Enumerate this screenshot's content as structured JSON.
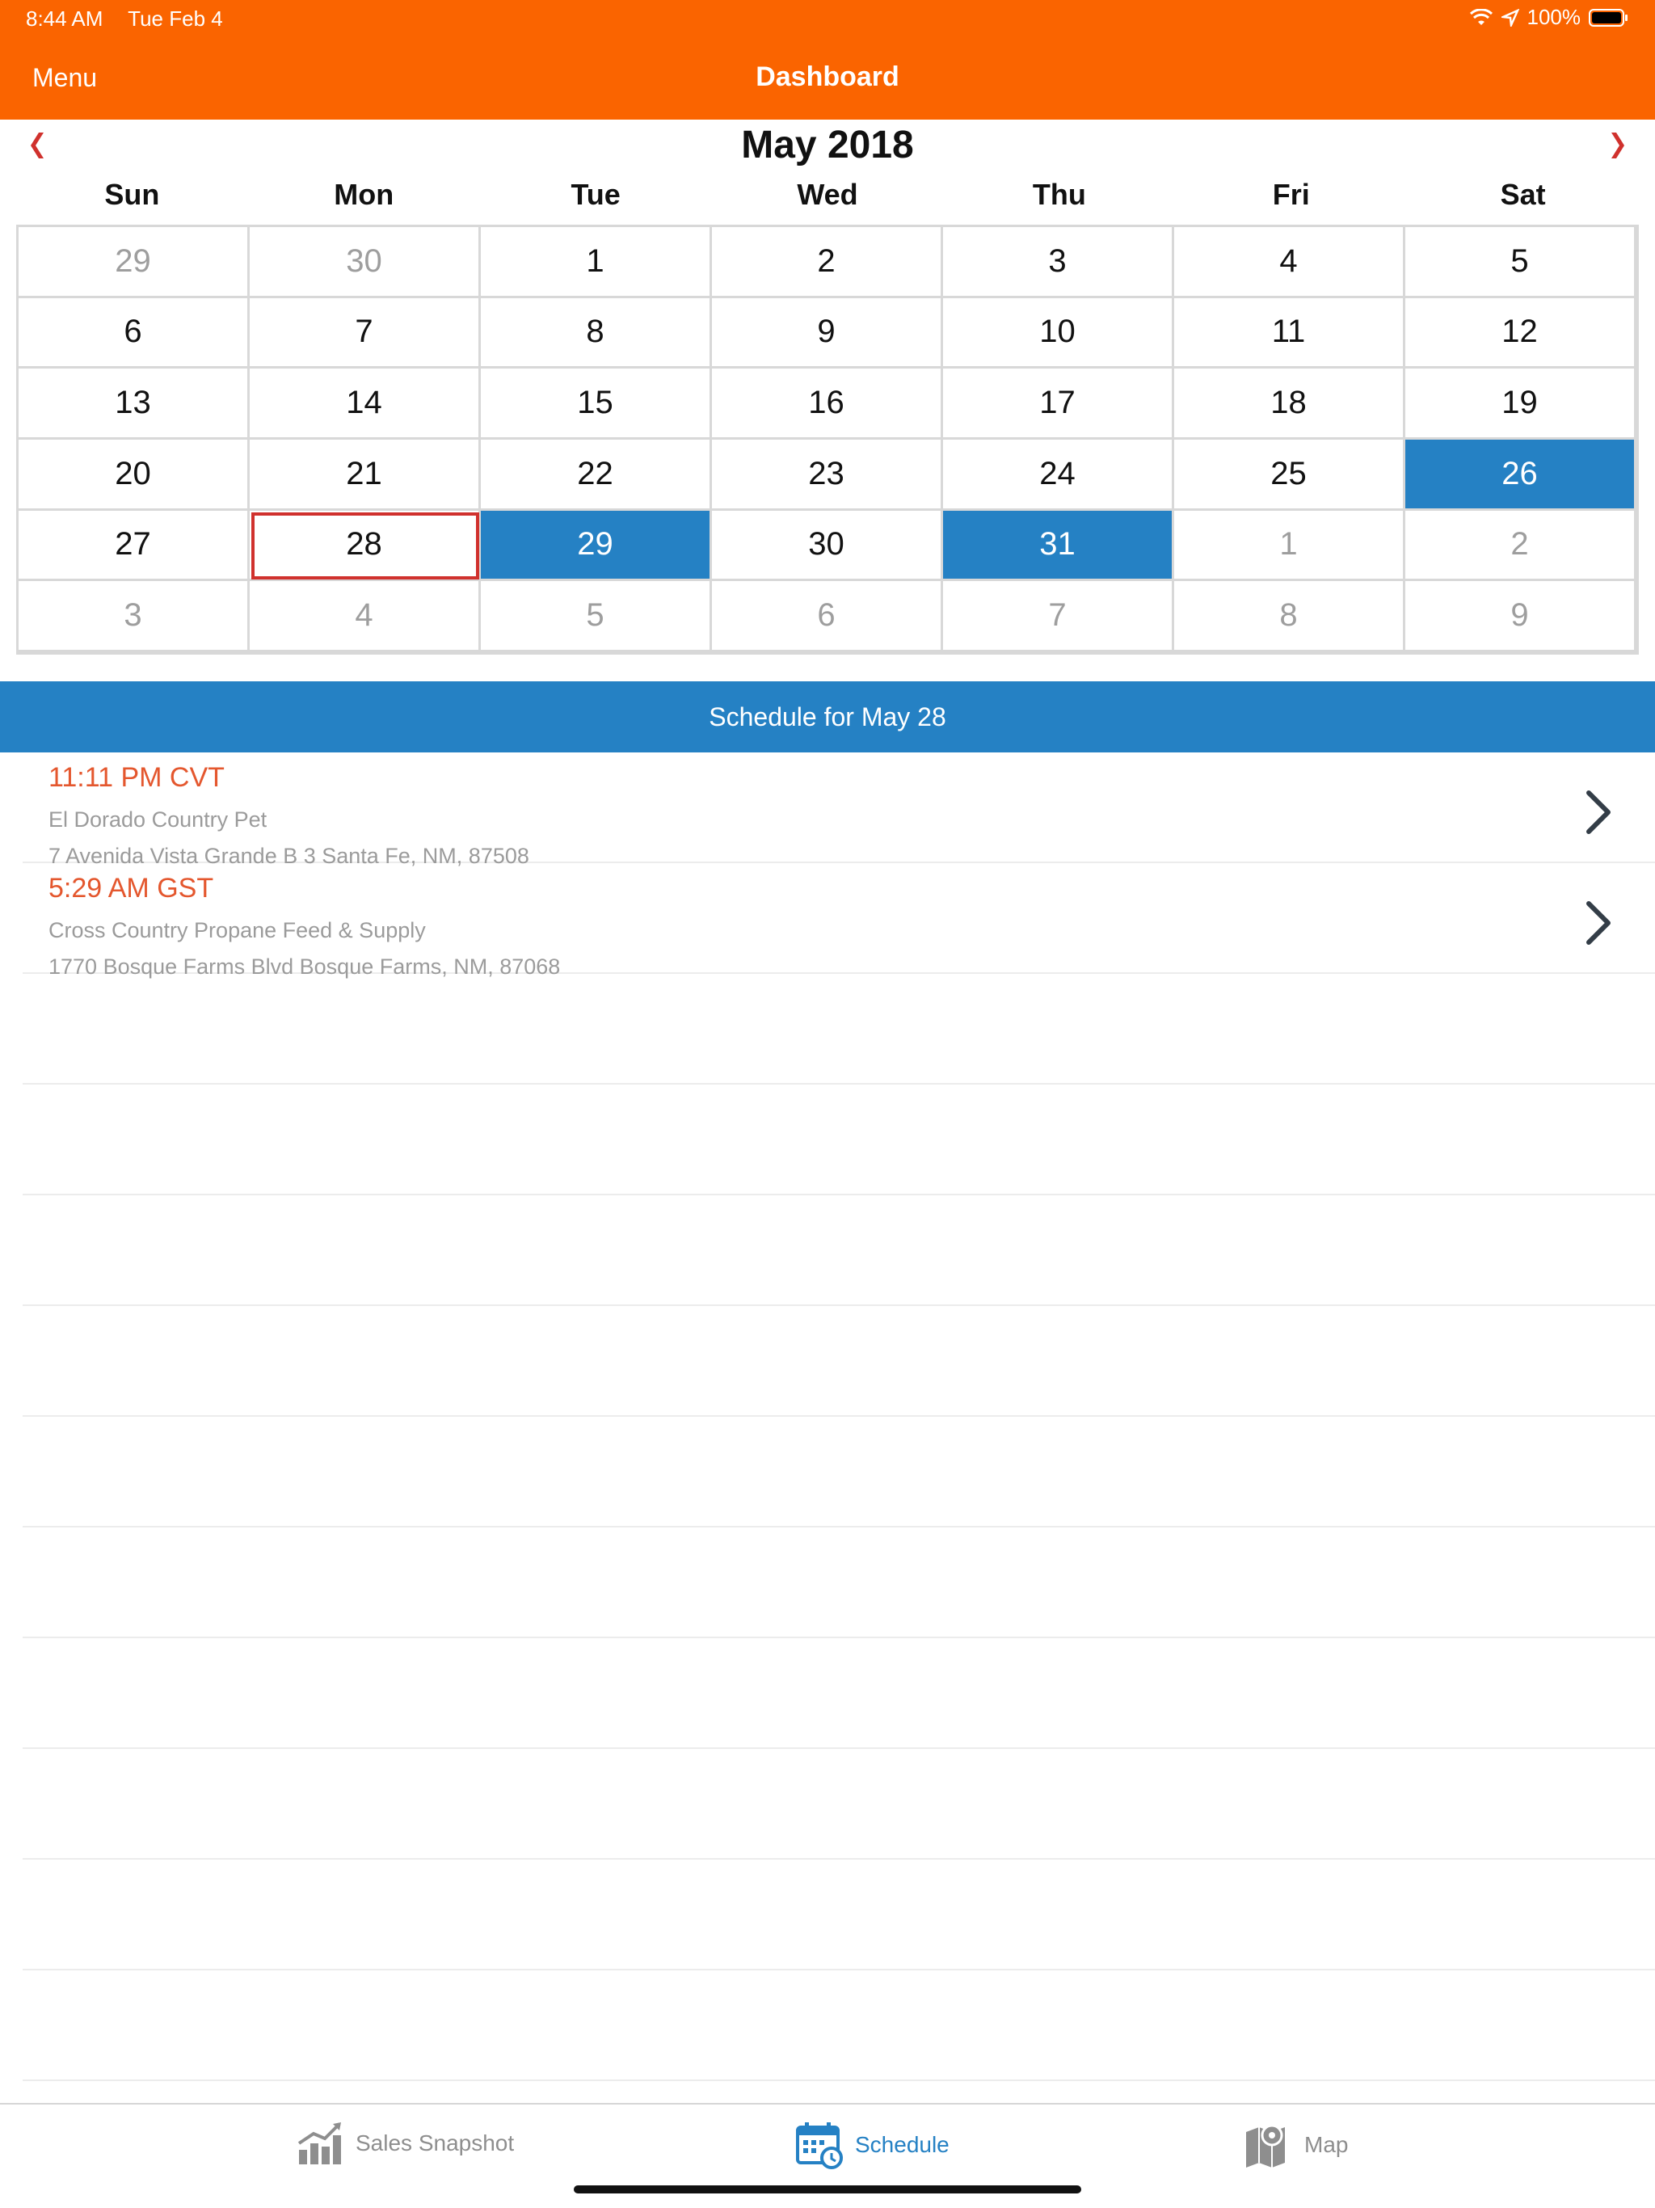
{
  "status_bar": {
    "time": "8:44 AM",
    "date": "Tue Feb 4",
    "battery": "100%"
  },
  "header": {
    "menu_label": "Menu",
    "title": "Dashboard"
  },
  "calendar": {
    "month_title": "May 2018",
    "weekdays": [
      "Sun",
      "Mon",
      "Tue",
      "Wed",
      "Thu",
      "Fri",
      "Sat"
    ],
    "weeks": [
      [
        "29",
        "30",
        "1",
        "2",
        "3",
        "4",
        "5"
      ],
      [
        "6",
        "7",
        "8",
        "9",
        "10",
        "11",
        "12"
      ],
      [
        "13",
        "14",
        "15",
        "16",
        "17",
        "18",
        "19"
      ],
      [
        "20",
        "21",
        "22",
        "23",
        "24",
        "25",
        "26"
      ],
      [
        "27",
        "28",
        "29",
        "30",
        "31",
        "1",
        "2"
      ],
      [
        "3",
        "4",
        "5",
        "6",
        "7",
        "8",
        "9"
      ]
    ]
  },
  "schedule": {
    "header": "Schedule for May 28",
    "items": [
      {
        "time": "11:11 PM CVT",
        "name": "El Dorado Country Pet",
        "address": "7 Avenida Vista Grande B 3 Santa Fe, NM, 87508"
      },
      {
        "time": "5:29 AM GST",
        "name": "Cross Country Propane Feed & Supply",
        "address": "1770 Bosque Farms Blvd Bosque Farms, NM, 87068"
      }
    ]
  },
  "tabs": {
    "sales_snapshot": "Sales Snapshot",
    "schedule": "Schedule",
    "map": "Map"
  },
  "colors": {
    "header": "#FA6400",
    "accent_blue": "#2581C4",
    "time_orange": "#E4572E",
    "today_border": "#D0312D"
  },
  "icons": {
    "prev": "chevron-left-icon",
    "next": "chevron-right-icon",
    "row": "chevron-right-icon",
    "sales": "chart-icon",
    "schedule": "calendar-clock-icon",
    "map": "map-pin-icon"
  }
}
